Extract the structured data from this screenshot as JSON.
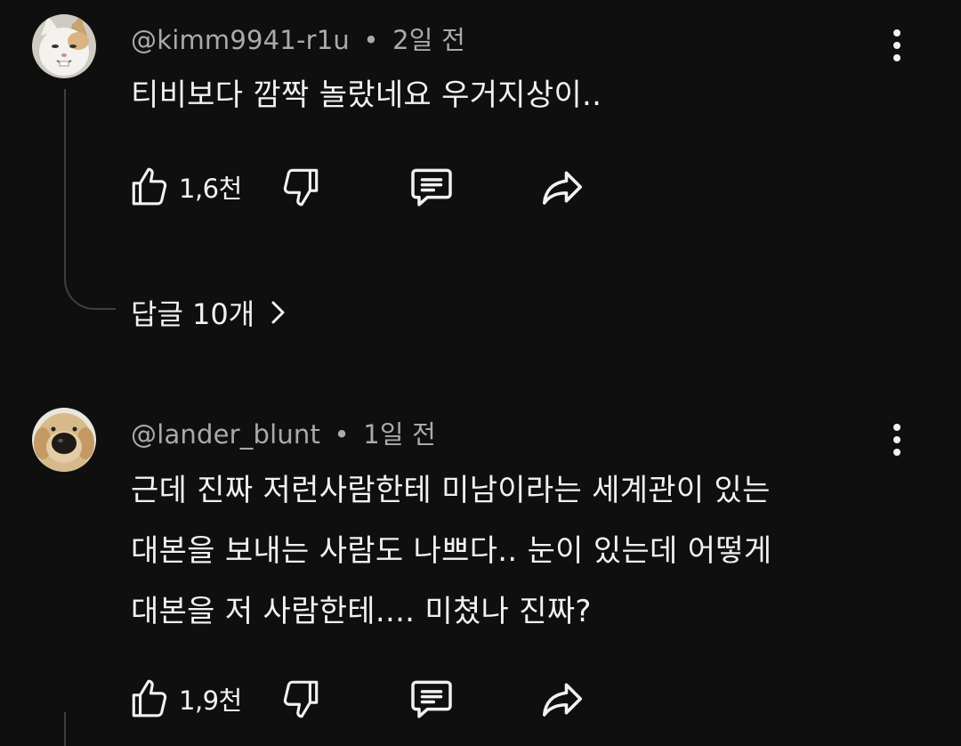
{
  "comments": [
    {
      "author": "@kimm9941-r1u",
      "separator": "•",
      "time": "2일 전",
      "text": "티비보다 깜짝 놀랐네요 우거지상이..",
      "likes": "1,6천",
      "replies_label": "답글 10개",
      "avatar": "cat-avatar"
    },
    {
      "author": "@lander_blunt",
      "separator": "•",
      "time": "1일 전",
      "text_lines": [
        "근데 진짜 저런사람한테 미남이라는 세계관이 있는",
        "대본을 보내는 사람도 나쁘다.. 눈이 있는데 어떻게",
        "대본을 저 사람한테.... 미쳤나 진짜?"
      ],
      "likes": "1,9천",
      "avatar": "dog-avatar"
    }
  ],
  "icons": {
    "like": "thumbs-up-icon",
    "dislike": "thumbs-down-icon",
    "reply": "comment-icon",
    "share": "share-icon",
    "more": "more-vertical-icon",
    "chevron": "chevron-right-icon"
  },
  "colors": {
    "background": "#0f0f0f",
    "primary_text": "#f1f1f1",
    "secondary_text": "#aaaaaa",
    "thread_line": "#3f3f3f"
  }
}
